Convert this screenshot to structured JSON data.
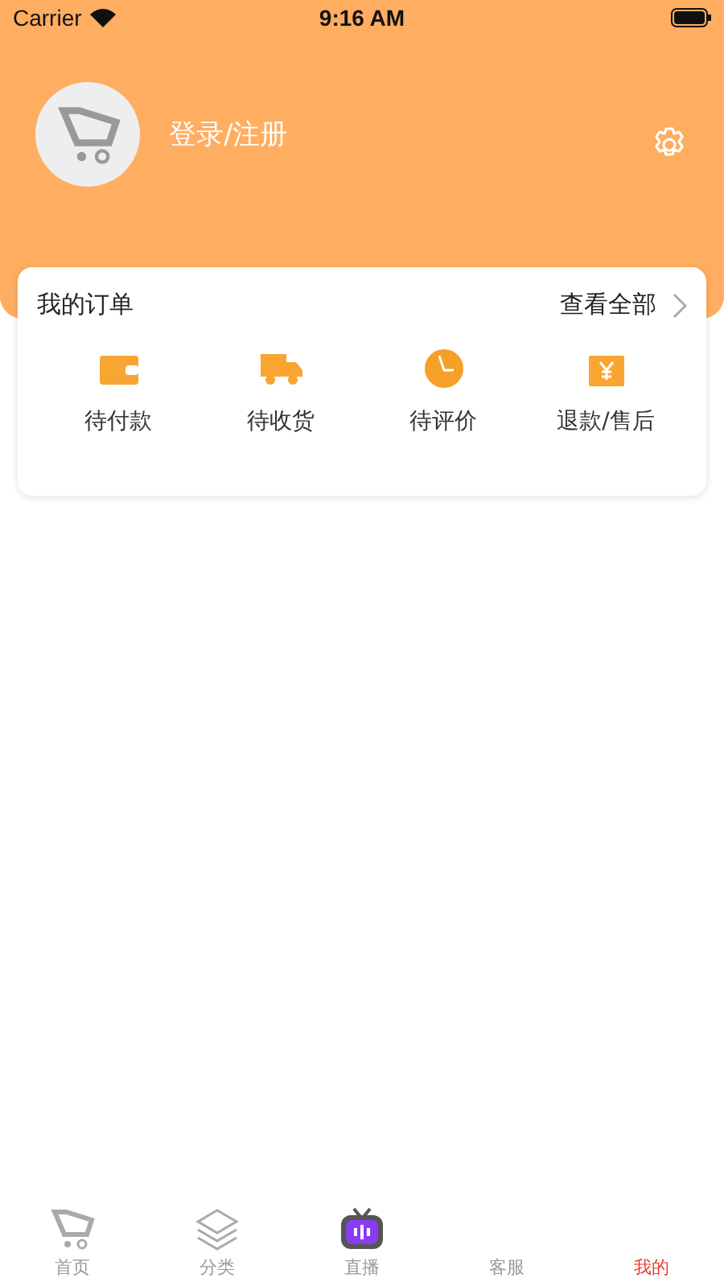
{
  "status_bar": {
    "carrier": "Carrier",
    "time": "9:16 AM"
  },
  "profile": {
    "login_label": "登录/注册"
  },
  "orders": {
    "title": "我的订单",
    "view_all": "查看全部",
    "items": [
      {
        "kind": "wallet",
        "label": "待付款"
      },
      {
        "kind": "truck",
        "label": "待收货"
      },
      {
        "kind": "clock",
        "label": "待评价"
      },
      {
        "kind": "refund",
        "label": "退款/售后"
      }
    ]
  },
  "tab_bar": [
    {
      "kind": "home",
      "label": "首页",
      "selected": false
    },
    {
      "kind": "layers",
      "label": "分类",
      "selected": false
    },
    {
      "kind": "tv",
      "label": "直播",
      "selected": false
    },
    {
      "kind": "hidden",
      "label": "客服",
      "selected": false
    },
    {
      "kind": "hidden",
      "label": "我的",
      "selected": true
    }
  ]
}
